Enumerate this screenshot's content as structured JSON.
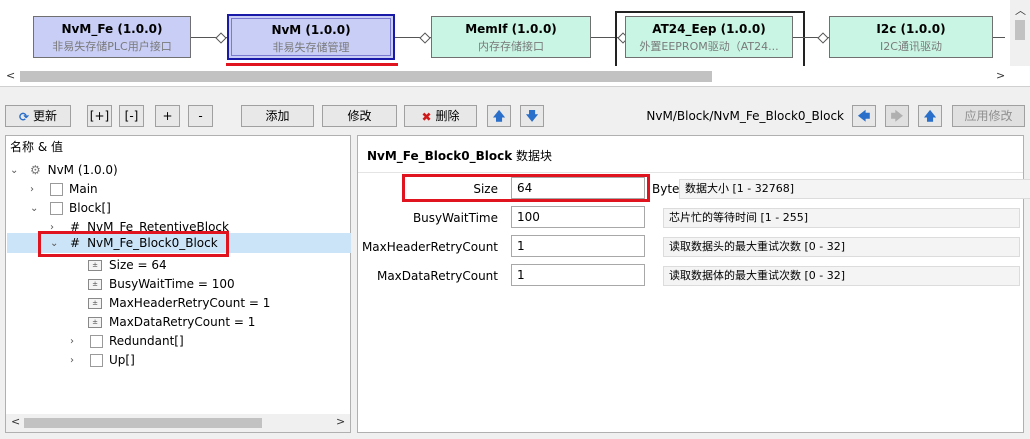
{
  "graph": {
    "modules": [
      {
        "title": "NvM_Fe (1.0.0)",
        "sub": "非易失存储PLC用户接口"
      },
      {
        "title": "NvM (1.0.0)",
        "sub": "非易失存储管理"
      },
      {
        "title": "MemIf (1.0.0)",
        "sub": "内存存储接口"
      },
      {
        "title": "AT24_Eep (1.0.0)",
        "sub": "外置EEPROM驱动（AT24..."
      },
      {
        "title": "I2c (1.0.0)",
        "sub": "I2C通讯驱动"
      }
    ],
    "colors": {
      "blue_module": "#c8cef5",
      "green_module": "#c8f5e4",
      "highlight": "#e0141e"
    }
  },
  "toolbar": {
    "refresh": "更新",
    "expand_all": "[+]",
    "collapse_all": "[-]",
    "expand": "+",
    "collapse": "-",
    "add": "添加",
    "modify": "修改",
    "delete": "删除",
    "path": "NvM/Block/NvM_Fe_Block0_Block",
    "apply": "应用修改"
  },
  "tree": {
    "header": "名称 & 值",
    "root": "NvM (1.0.0)",
    "main": "Main",
    "block": "Block[]",
    "retentive": "NvM_Fe_RetentiveBlock",
    "block0": "NvM_Fe_Block0_Block",
    "values": [
      "Size = 64",
      "BusyWaitTime = 100",
      "MaxHeaderRetryCount = 1",
      "MaxDataRetryCount = 1"
    ],
    "redundant": "Redundant[]",
    "up": "Up[]"
  },
  "detail": {
    "title": "NvM_Fe_Block0_Block",
    "title_suffix": "数据块",
    "params": [
      {
        "label": "Size",
        "value": "64",
        "unit": "Byte",
        "desc": "数据大小 [1 - 32768]"
      },
      {
        "label": "BusyWaitTime",
        "value": "100",
        "unit": "",
        "desc": "芯片忙的等待时间 [1 - 255]"
      },
      {
        "label": "MaxHeaderRetryCount",
        "value": "1",
        "unit": "",
        "desc": "读取数据头的最大重试次数 [0 - 32]"
      },
      {
        "label": "MaxDataRetryCount",
        "value": "1",
        "unit": "",
        "desc": "读取数据体的最大重试次数 [0 - 32]"
      }
    ]
  }
}
